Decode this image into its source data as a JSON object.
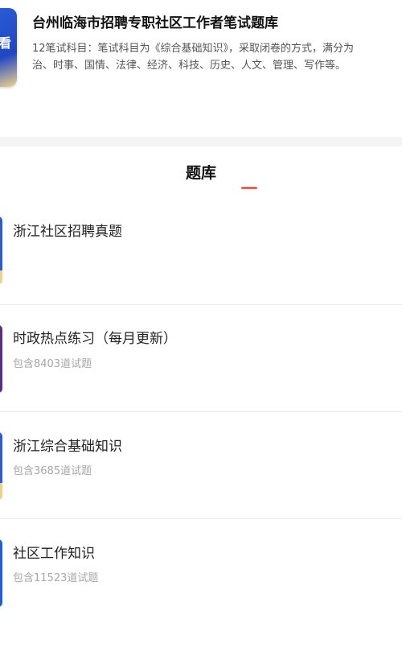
{
  "header": {
    "title": "台州临海市招聘专职社区工作者笔试题库",
    "desc_line1": "12笔试科目：笔试科目为《综合基础知识》，采取闭卷的方式，满分为",
    "desc_line2": "治、时事、国情、法律、经济、科技、历史、人文、管理、写作等。",
    "cover_glyph": "看"
  },
  "section": {
    "title": "题库"
  },
  "items": [
    {
      "name": "浙江社区招聘真题",
      "count": ""
    },
    {
      "name": "时政热点练习（每月更新）",
      "count": "包含8403道试题"
    },
    {
      "name": "浙江综合基础知识",
      "count": "包含3685道试题"
    },
    {
      "name": "社区工作知识",
      "count": "包含11523道试题"
    }
  ]
}
